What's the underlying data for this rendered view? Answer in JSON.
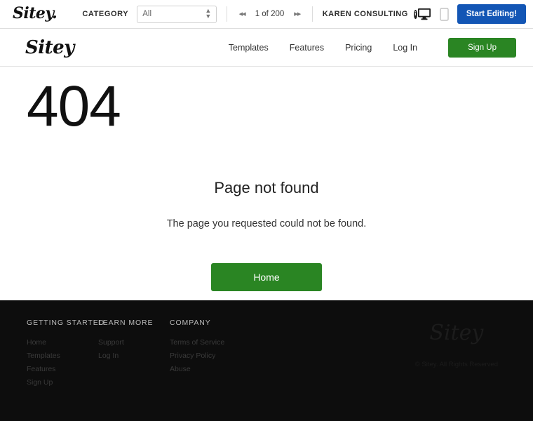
{
  "editor_bar": {
    "logo_text": "Sitey.",
    "category_label": "CATEGORY",
    "category_value": "All",
    "category_options": [
      "All"
    ],
    "prev_icon": "◂◂",
    "next_icon": "▸▸",
    "page_count": "1 of 200",
    "site_name": "KAREN CONSULTING",
    "badge_glyph": "i",
    "desktop_icon": "desktop-view-icon",
    "mobile_icon": "mobile-view-icon",
    "start_editing_label": "Start Editing!",
    "start_editing_color": "#1356b5"
  },
  "site_header": {
    "logo_text": "Sitey",
    "nav": [
      {
        "label": "Templates"
      },
      {
        "label": "Features"
      },
      {
        "label": "Pricing"
      },
      {
        "label": "Log In"
      }
    ],
    "signup_label": "Sign Up",
    "signup_color": "#2a8523"
  },
  "main": {
    "error_code": "404",
    "title": "Page not found",
    "message": "The page you requested could not be found.",
    "home_button_label": "Home",
    "home_button_color": "#2a8523"
  },
  "footer": {
    "columns": [
      {
        "heading": "GETTING STARTED",
        "links": [
          "Home",
          "Templates",
          "Features",
          "Sign Up"
        ]
      },
      {
        "heading": "LEARN MORE",
        "links": [
          "Support",
          "Log In"
        ]
      },
      {
        "heading": "COMPANY",
        "links": [
          "Terms of Service",
          "Privacy Policy",
          "Abuse"
        ]
      }
    ],
    "brand_logo": "Sitey",
    "copyright": "© Sitey. All Rights Reserved",
    "background": "#0d0d0d"
  }
}
